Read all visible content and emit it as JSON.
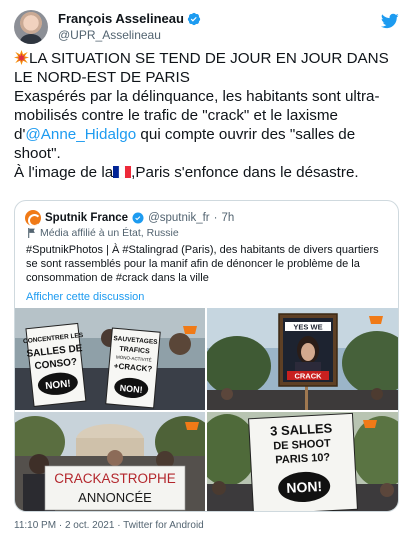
{
  "author": {
    "name": "François Asselineau",
    "handle": "@UPR_Asselineau"
  },
  "tweet": {
    "line1": "LA SITUATION SE TEND DE JOUR EN JOUR DANS LE NORD-EST DE PARIS",
    "line2": "Exaspérés par la délinquance, les habitants sont ultra-mobilisés contre le trafic de \"crack\" et le laxisme d'",
    "mention": "@Anne_Hidalgo",
    "line3": " qui compte ouvrir des \"salles de shoot\".",
    "line4a": "À l'image de la",
    "line4b": ",Paris s'enfonce dans le désastre."
  },
  "quote": {
    "name": "Sputnik France",
    "handle": "@sputnik_fr",
    "time": "7h",
    "affiliation": "Média affilié à un État, Russie",
    "text": "#SputnikPhotos | À #Stalingrad (Paris), des habitants de divers quartiers se sont rassemblés pour la manif afin de dénoncer le problème de la consommation de #crack dans la ville",
    "link": "Afficher cette discussion",
    "photos": {
      "p1_sign1": [
        "CONCENTRER LES",
        "SALLES DE",
        "CONSO?",
        "NON!"
      ],
      "p1_sign2": [
        "SAUVETAGES",
        "TRAFICS",
        "MONO-ACTIVITÉ",
        "+CRACK?",
        "NON!"
      ],
      "p2_sign": [
        "YES WE",
        "CRACK"
      ],
      "p3_sign": [
        "CRACKASTROPHE",
        "ANNONCÉE"
      ],
      "p4_sign": [
        "3 SALLES",
        "DE SHOOT",
        "PARIS 10?",
        "NON!"
      ]
    }
  },
  "footer": {
    "meta": "11:10 PM · 2 oct. 2021 · Twitter for Android"
  },
  "icons": {
    "verified": "verified-badge-icon",
    "logo": "twitter-logo-icon",
    "flag": "france-flag-icon",
    "collision": "collision-emoji-icon"
  },
  "colors": {
    "accent": "#1d9bf0",
    "text": "#0f1419",
    "muted": "#536471"
  }
}
